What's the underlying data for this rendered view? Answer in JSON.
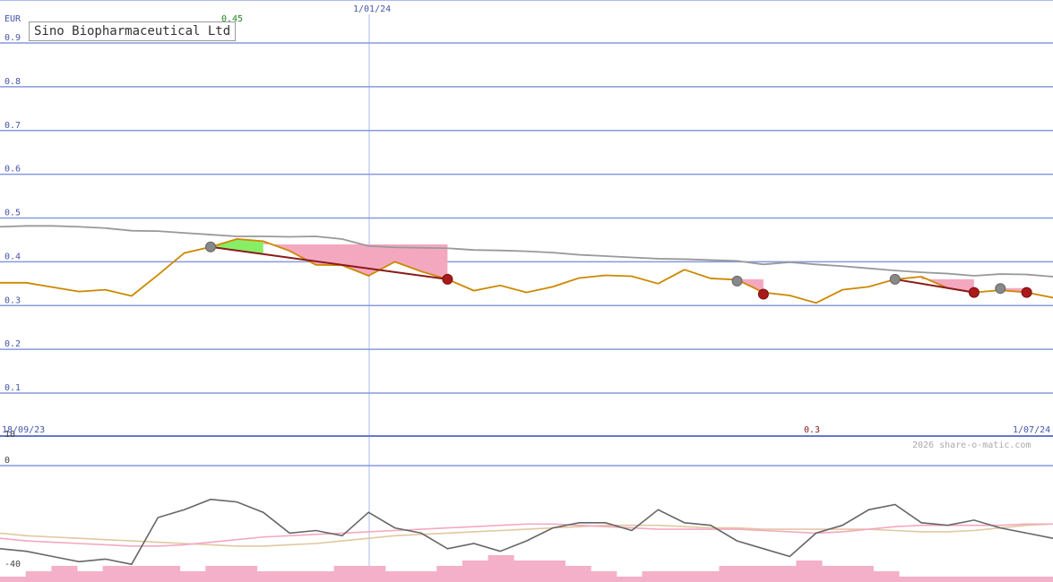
{
  "chart_data": [
    {
      "type": "line",
      "title": "Sino Biopharmaceutical Ltd",
      "currency": "EUR",
      "ylim": [
        0,
        0.9
      ],
      "yticks": [
        0.1,
        0.2,
        0.3,
        0.4,
        0.5,
        0.6,
        0.7,
        0.8,
        0.9
      ],
      "ytick_labels": [
        "0.1",
        "0.2",
        "0.3",
        "0.4",
        "0.5",
        "0.6",
        "0.7",
        "0.8",
        "0.9"
      ],
      "x_labels": {
        "start": "18/09/23",
        "mid": "1/01/24",
        "end": "1/07/24"
      },
      "annotations": {
        "high": "0.45",
        "low": "0.3"
      },
      "copyright": "2026 share-o-matic.com",
      "grid": true,
      "series": [
        {
          "color": "#cc8800",
          "values": [
            0.352,
            0.352,
            0.342,
            0.332,
            0.336,
            0.322,
            0.37,
            0.42,
            0.434,
            0.452,
            0.447,
            0.425,
            0.393,
            0.392,
            0.368,
            0.4,
            0.378,
            0.36,
            0.334,
            0.346,
            0.33,
            0.343,
            0.363,
            0.369,
            0.367,
            0.35,
            0.382,
            0.362,
            0.359,
            0.33,
            0.323,
            0.306,
            0.336,
            0.343,
            0.36,
            0.366,
            0.34,
            0.33,
            0.335,
            0.33,
            0.318
          ]
        },
        {
          "color": "#999999",
          "values": [
            0.48,
            0.482,
            0.482,
            0.48,
            0.477,
            0.471,
            0.47,
            0.466,
            0.462,
            0.458,
            0.458,
            0.457,
            0.458,
            0.452,
            0.436,
            0.433,
            0.432,
            0.431,
            0.427,
            0.426,
            0.424,
            0.421,
            0.416,
            0.413,
            0.41,
            0.407,
            0.406,
            0.404,
            0.402,
            0.394,
            0.399,
            0.394,
            0.39,
            0.385,
            0.38,
            0.376,
            0.373,
            0.368,
            0.372,
            0.371,
            0.366
          ]
        }
      ],
      "trade_lines": [
        {
          "from": [
            8,
            0.434
          ],
          "to": [
            17,
            0.36
          ]
        },
        {
          "from": [
            34,
            0.36
          ],
          "to": [
            37,
            0.33
          ]
        }
      ],
      "buy_markers": [
        [
          8,
          0.434
        ],
        [
          28,
          0.356
        ],
        [
          34,
          0.36
        ],
        [
          38,
          0.339
        ]
      ],
      "sell_markers": [
        [
          17,
          0.36
        ],
        [
          29,
          0.326
        ],
        [
          37,
          0.33
        ],
        [
          39,
          0.33
        ]
      ],
      "gain_fill": {
        "range": [
          8,
          10
        ],
        "color": "#88ee66"
      },
      "loss_fills": [
        {
          "range": [
            10,
            17
          ],
          "top": 0.44,
          "color": "#f4a8c0"
        },
        {
          "range": [
            28,
            29
          ],
          "top": 0.36,
          "color": "#f4a8c0"
        },
        {
          "range": [
            35,
            37
          ],
          "top": 0.36,
          "color": "#f4a8c0"
        },
        {
          "range": [
            38,
            39
          ],
          "top": 0.34,
          "color": "#f4a8c0"
        }
      ]
    },
    {
      "type": "line",
      "yticks": [
        10,
        0,
        -40
      ],
      "ytick_labels": [
        "10",
        "0",
        "-40"
      ],
      "ylim": [
        -40,
        10
      ],
      "series": [
        {
          "color": "#666666",
          "values": [
            -32,
            -33,
            -35,
            -37,
            -36,
            -38,
            -20,
            -17,
            -13,
            -14,
            -18,
            -26,
            -25,
            -27,
            -18,
            -24,
            -26,
            -32,
            -30,
            -33,
            -29,
            -24,
            -22,
            -22,
            -25,
            -17,
            -22,
            -23,
            -29,
            -32,
            -35,
            -26,
            -23,
            -17,
            -15,
            -22,
            -23,
            -21,
            -24,
            -26,
            -28
          ]
        },
        {
          "color": "#f4a8c0",
          "values": [
            -28,
            -29,
            -29.5,
            -30,
            -30.5,
            -31,
            -31,
            -30.5,
            -29.5,
            -28.5,
            -27.5,
            -27,
            -26.5,
            -26,
            -25.5,
            -25,
            -24.5,
            -24,
            -23.5,
            -23,
            -22.5,
            -22.5,
            -23,
            -23.5,
            -24,
            -24.5,
            -24.5,
            -24.5,
            -24.5,
            -25,
            -25.5,
            -26,
            -25.5,
            -24.5,
            -23.5,
            -23,
            -23,
            -23,
            -23,
            -22.5,
            -22.5
          ]
        },
        {
          "color": "#e0c8a0",
          "values": [
            -26,
            -27,
            -27.5,
            -28,
            -28.5,
            -29,
            -29.5,
            -30,
            -30.5,
            -31,
            -31,
            -30.5,
            -30,
            -29,
            -28,
            -27,
            -26.5,
            -26,
            -25.5,
            -25,
            -24.5,
            -24,
            -23.5,
            -23,
            -23,
            -23,
            -23.5,
            -24,
            -24,
            -24.5,
            -24.5,
            -24.5,
            -24.5,
            -24.5,
            -25,
            -25.5,
            -25.5,
            -25,
            -24,
            -23,
            -22.5
          ]
        }
      ],
      "volume_bars": {
        "color": "#f4b0c8",
        "values": [
          1,
          2,
          3,
          2,
          3,
          3,
          3,
          2,
          3,
          3,
          2,
          2,
          2,
          3,
          3,
          2,
          2,
          3,
          4,
          5,
          4,
          4,
          3,
          2,
          1,
          2,
          2,
          2,
          3,
          3,
          3,
          4,
          3,
          3,
          2,
          1,
          1,
          1,
          1,
          1,
          1
        ]
      }
    }
  ]
}
